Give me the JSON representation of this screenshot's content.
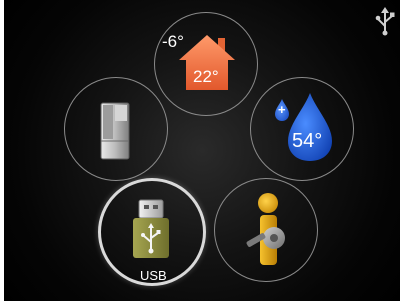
{
  "menu": {
    "indoor_climate": {
      "outdoor_temp": "-6°",
      "room_temp": "22°"
    },
    "hot_water": {
      "temp": "54°",
      "plus": "+"
    },
    "usb": {
      "label": "USB",
      "selected": true
    }
  },
  "colors": {
    "house": "#f07a4d",
    "water": "#1f5fd6",
    "usb_stick": "#8f8f3f",
    "service_person": "#e8b11a",
    "selection_ring": "#d9d9d9"
  },
  "icons": {
    "status": "usb-connected-icon",
    "house": "house-icon",
    "water": "water-drop-icon",
    "unit": "heat-pump-unit-icon",
    "usb": "usb-stick-icon",
    "service": "service-person-icon"
  }
}
